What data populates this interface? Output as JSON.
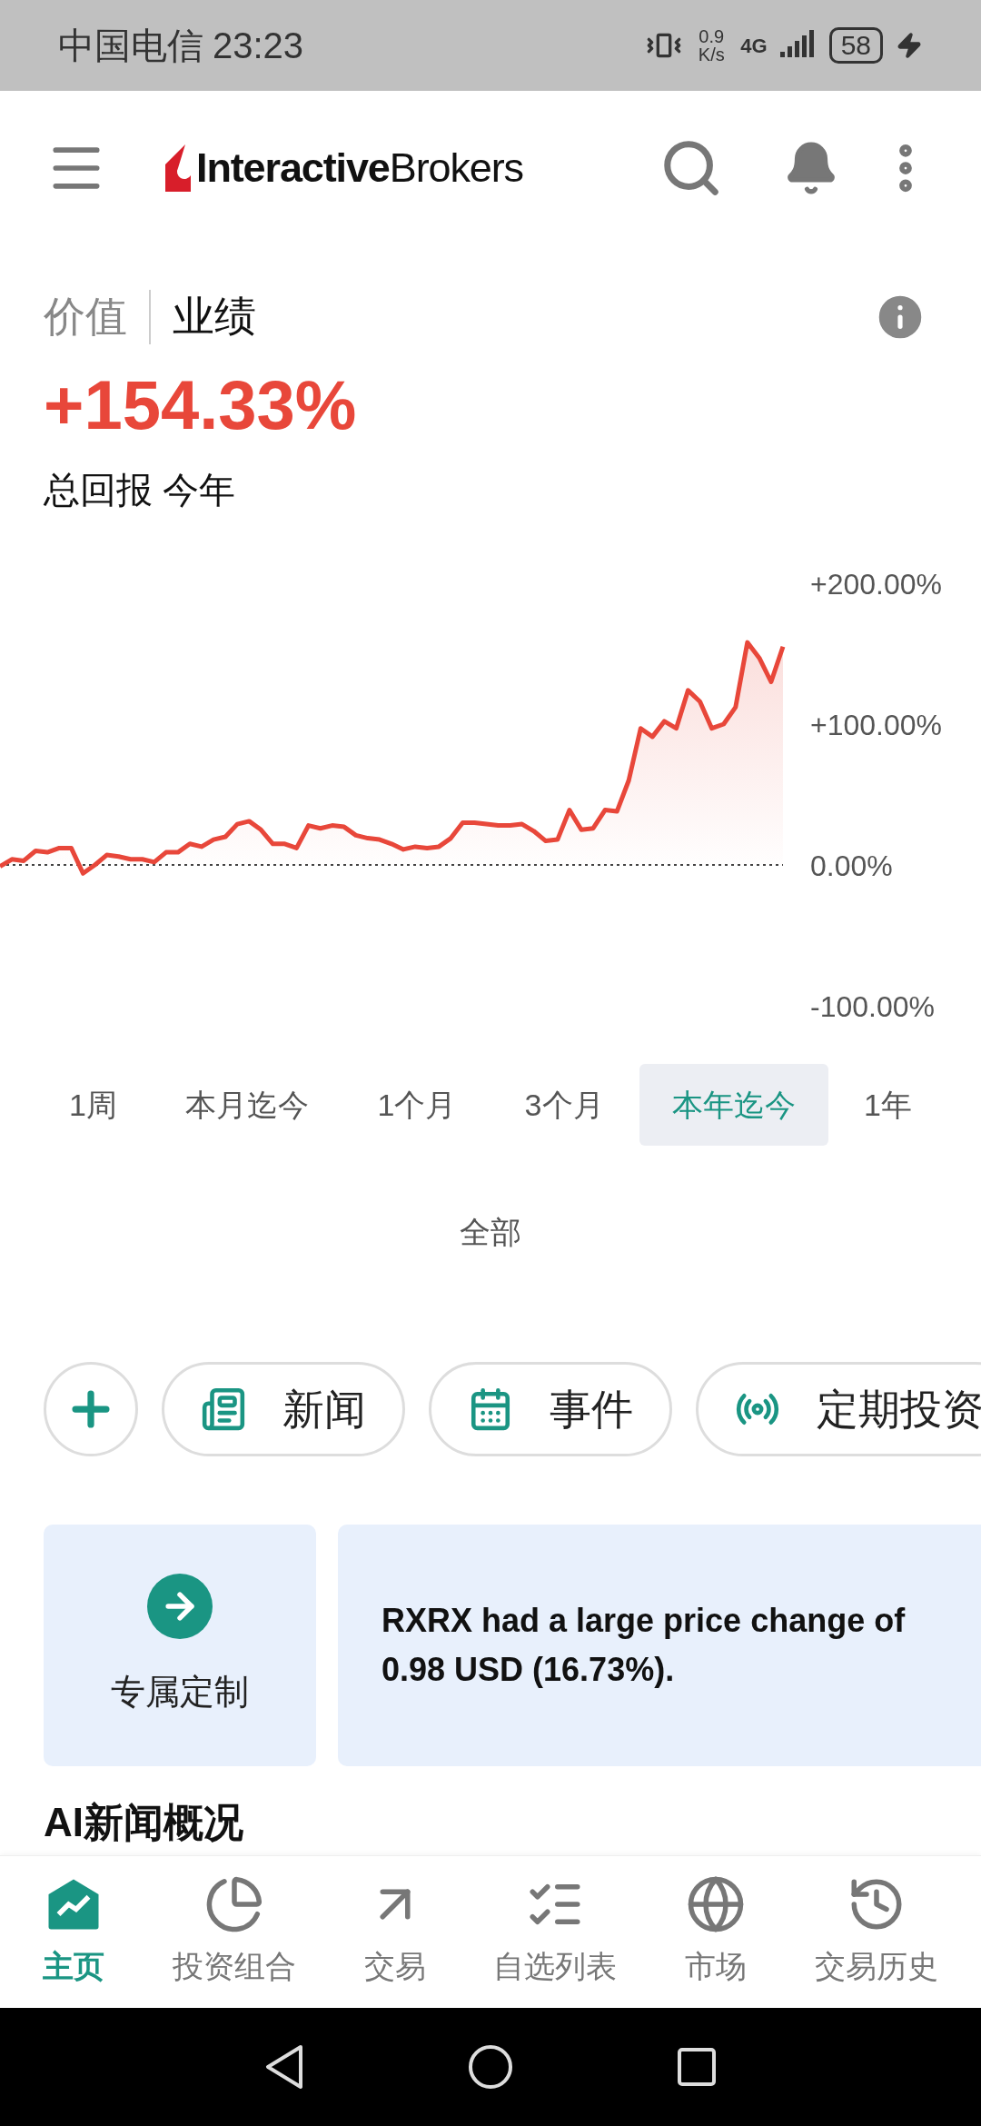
{
  "status_bar": {
    "carrier": "中国电信",
    "time": "23:23",
    "speed": "0.9 K/s",
    "network": "4G",
    "battery": "58"
  },
  "header": {
    "logo": "**Interactive**Brokers"
  },
  "view_tabs": [
    {
      "label": "价值",
      "selected": false
    },
    {
      "label": "业绩",
      "selected": true
    }
  ],
  "summary": {
    "value": "+154.33%",
    "caption": "总回报 今年"
  },
  "chart_data": {
    "type": "area",
    "yticks": [
      {
        "value": 200,
        "label": "+200.00%"
      },
      {
        "value": 100,
        "label": "+100.00%"
      },
      {
        "value": 0,
        "label": "0.00%"
      },
      {
        "value": -100,
        "label": "-100.00%"
      }
    ],
    "ylim": [
      -100,
      200
    ],
    "series": [
      {
        "color": "#e8473a",
        "values": [
          -1,
          4,
          3,
          10,
          9,
          12,
          12,
          -6,
          0,
          7,
          6,
          4,
          4,
          2,
          9,
          9,
          15,
          13,
          18,
          20,
          29,
          31,
          25,
          15,
          15,
          12,
          28,
          26,
          28,
          27,
          21,
          19,
          18,
          15,
          11,
          13,
          12,
          13,
          19,
          30,
          30,
          29,
          28,
          28,
          29,
          24,
          17,
          18,
          39,
          25,
          26,
          39,
          38,
          60,
          97,
          91,
          102,
          97,
          124,
          116,
          97,
          100,
          112,
          158,
          147,
          130,
          155
        ]
      }
    ]
  },
  "ranges": [
    {
      "label": "1周",
      "selected": false
    },
    {
      "label": "本月迄今",
      "selected": false
    },
    {
      "label": "1个月",
      "selected": false
    },
    {
      "label": "3个月",
      "selected": false
    },
    {
      "label": "本年迄今",
      "selected": true
    },
    {
      "label": "1年",
      "selected": false
    },
    {
      "label": "全部",
      "selected": false
    }
  ],
  "chips": [
    {
      "kind": "news",
      "label": "新闻"
    },
    {
      "kind": "events",
      "label": "事件"
    },
    {
      "kind": "recurring",
      "label": "定期投资"
    }
  ],
  "cards": [
    {
      "kind": "action",
      "label": "专属定制"
    },
    {
      "kind": "alert",
      "text": "RXRX had a large price change of 0.98 USD (16.73%)."
    }
  ],
  "section_title": "AI新闻概况",
  "bottom_nav": [
    {
      "kind": "home",
      "label": "主页",
      "selected": true
    },
    {
      "kind": "portfolio",
      "label": "投资组合",
      "selected": false
    },
    {
      "kind": "trade",
      "label": "交易",
      "selected": false
    },
    {
      "kind": "watchlist",
      "label": "自选列表",
      "selected": false
    },
    {
      "kind": "market",
      "label": "市场",
      "selected": false
    },
    {
      "kind": "history",
      "label": "交易历史",
      "selected": false
    }
  ]
}
